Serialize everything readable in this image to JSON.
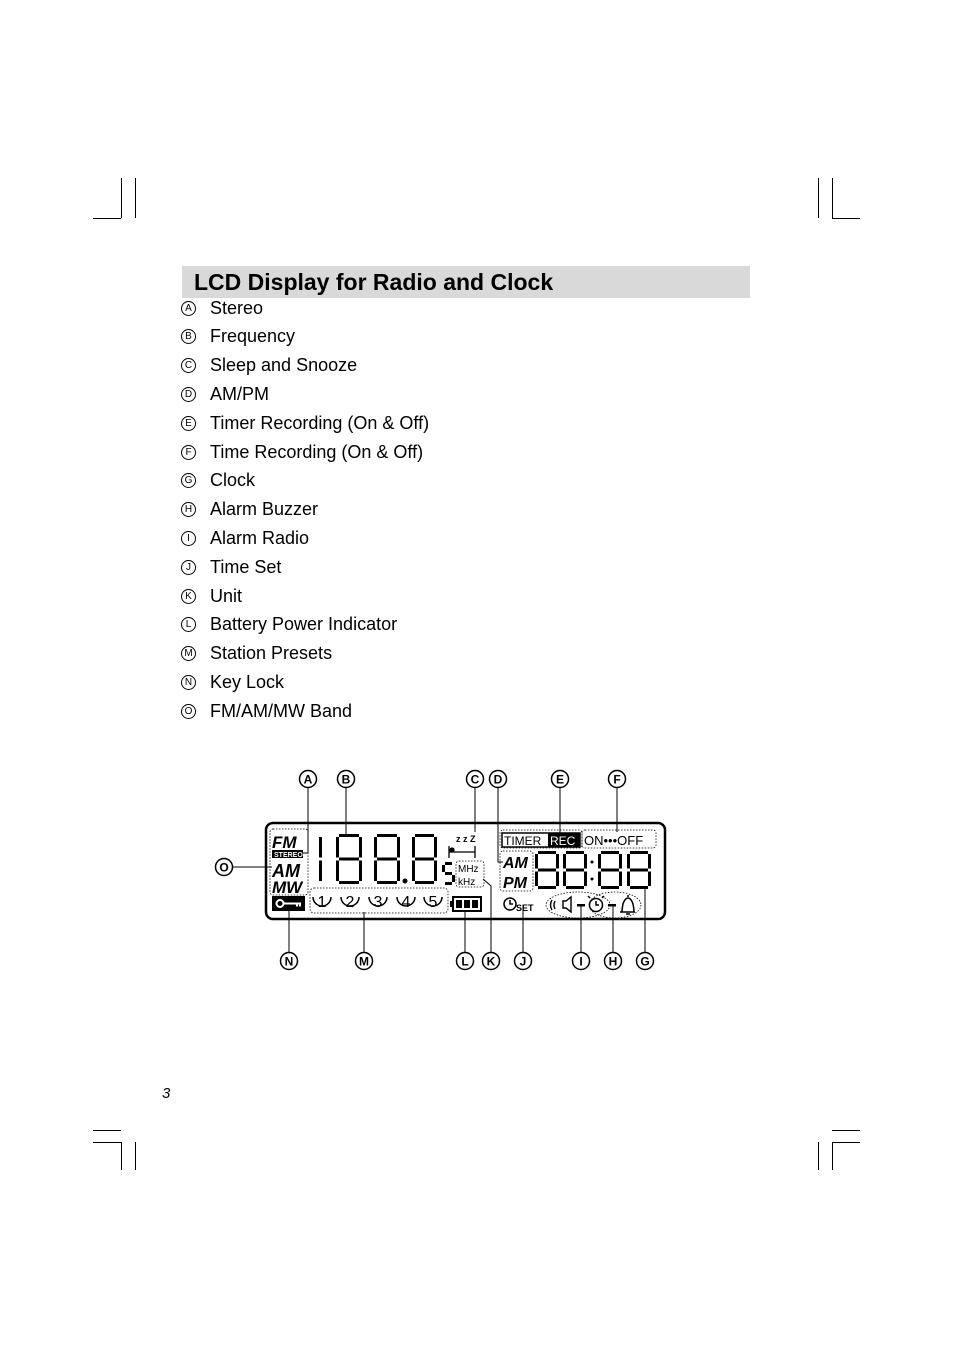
{
  "title": "LCD Display for Radio and Clock",
  "items": [
    {
      "letter": "A",
      "label": "Stereo"
    },
    {
      "letter": "B",
      "label": "Frequency"
    },
    {
      "letter": "C",
      "label": "Sleep and Snooze"
    },
    {
      "letter": "D",
      "label": "AM/PM"
    },
    {
      "letter": "E",
      "label": "Timer Recording (On & Off)"
    },
    {
      "letter": "F",
      "label": "Time Recording (On & Off)"
    },
    {
      "letter": "G",
      "label": "Clock"
    },
    {
      "letter": "H",
      "label": "Alarm Buzzer"
    },
    {
      "letter": "I",
      "label": "Alarm Radio"
    },
    {
      "letter": "J",
      "label": "Time Set"
    },
    {
      "letter": "K",
      "label": "Unit"
    },
    {
      "letter": "L",
      "label": "Battery Power Indicator"
    },
    {
      "letter": "M",
      "label": "Station Presets"
    },
    {
      "letter": "N",
      "label": "Key Lock"
    },
    {
      "letter": "O",
      "label": "FM/AM/MW Band"
    }
  ],
  "lcd": {
    "fm": "FM",
    "stereo": "STEREO",
    "am": "AM",
    "mw": "MW",
    "presets": [
      "1",
      "2",
      "3",
      "4",
      "5"
    ],
    "mhz": "MHz",
    "khz": "kHz",
    "zzz": "z z Z",
    "timer": "TIMER",
    "rec": "REC",
    "on_off": "ON•••OFF",
    "am_clock": "AM",
    "pm_clock": "PM",
    "set": "SET"
  },
  "page_number": "3"
}
